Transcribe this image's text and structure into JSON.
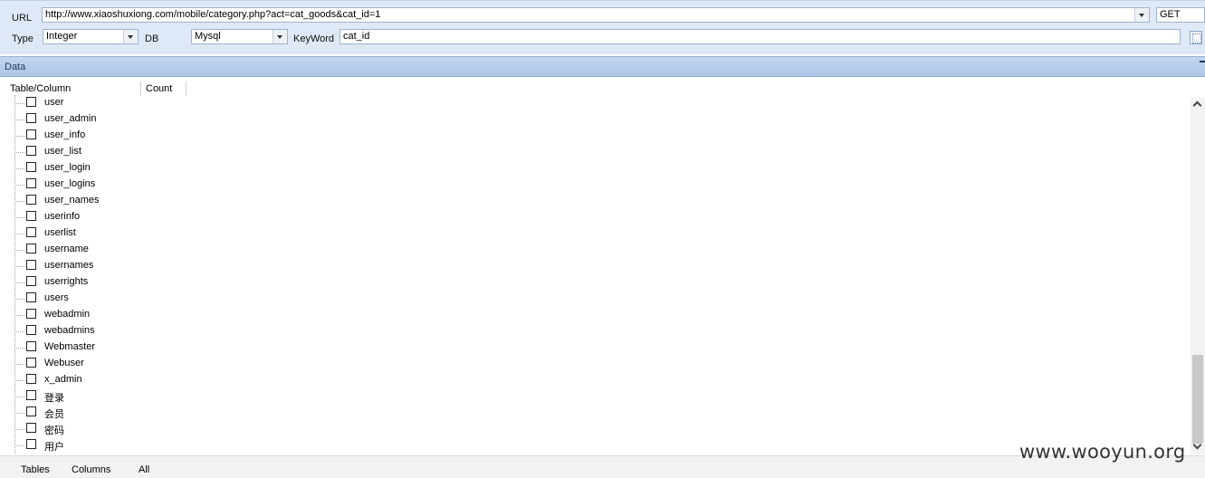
{
  "toolbar": {
    "url_label": "URL",
    "url_value": "http://www.xiaoshuxiong.com/mobile/category.php?act=cat_goods&cat_id=1",
    "method_value": "GET",
    "type_label": "Type",
    "type_value": "Integer",
    "db_label": "DB",
    "db_value": "Mysql",
    "keyword_label": "KeyWord",
    "keyword_value": "cat_id"
  },
  "panel": {
    "title": "Data",
    "columns": [
      "Table/Column",
      "Count"
    ]
  },
  "tree": {
    "items": [
      "user",
      "user_admin",
      "user_info",
      "user_list",
      "user_login",
      "user_logins",
      "user_names",
      "userinfo",
      "userlist",
      "username",
      "usernames",
      "userrights",
      "users",
      "webadmin",
      "webadmins",
      "Webmaster",
      "Webuser",
      "x_admin",
      "登录",
      "会员",
      "密码",
      "用户"
    ]
  },
  "bottom_tabs": [
    "Tables",
    "Columns",
    "All"
  ],
  "watermark": "www.wooyun.org"
}
